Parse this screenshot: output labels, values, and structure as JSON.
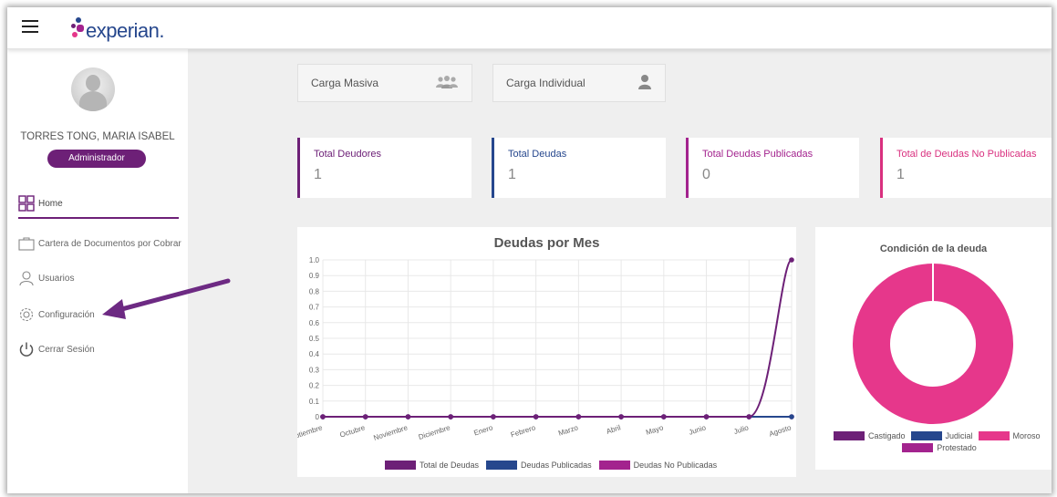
{
  "header": {
    "brand": "experian.",
    "menu_icon": "hamburger-menu-icon"
  },
  "sidebar": {
    "user_name": "TORRES TONG, MARIA ISABEL",
    "role": "Administrador",
    "items": [
      {
        "label": "Home",
        "icon": "grid-icon"
      },
      {
        "label": "Cartera de Documentos por Cobrar",
        "icon": "briefcase-icon"
      },
      {
        "label": "Usuarios",
        "icon": "user-icon"
      },
      {
        "label": "Configuración",
        "icon": "gear-icon"
      },
      {
        "label": "Cerrar Sesión",
        "icon": "power-icon"
      }
    ]
  },
  "upload": {
    "masiva": {
      "label": "Carga Masiva",
      "icon": "users-group-icon"
    },
    "individual": {
      "label": "Carga Individual",
      "icon": "person-icon"
    }
  },
  "stats": [
    {
      "label": "Total Deudores",
      "value": "1",
      "color": "#6d2077"
    },
    {
      "label": "Total Deudas",
      "value": "1",
      "color": "#26478d"
    },
    {
      "label": "Total Deudas Publicadas",
      "value": "0",
      "color": "#a3238e"
    },
    {
      "label": "Total de Deudas No Publicadas",
      "value": "1",
      "color": "#d9307f"
    }
  ],
  "chart_data": [
    {
      "type": "line",
      "title": "Deudas por Mes",
      "categories": [
        "Septiembre",
        "Octubre",
        "Noviembre",
        "Diciembre",
        "Enero",
        "Febrero",
        "Marzo",
        "Abril",
        "Mayo",
        "Junio",
        "Julio",
        "Agosto"
      ],
      "ylim": [
        0,
        1.0
      ],
      "yticks": [
        "0",
        "0.1",
        "0.2",
        "0.3",
        "0.4",
        "0.5",
        "0.6",
        "0.7",
        "0.8",
        "0.9",
        "1.0"
      ],
      "grid": true,
      "legend_position": "bottom",
      "series": [
        {
          "name": "Total de Deudas",
          "color": "#6d2077",
          "values": [
            0,
            0,
            0,
            0,
            0,
            0,
            0,
            0,
            0,
            0,
            0,
            1
          ]
        },
        {
          "name": "Deudas Publicadas",
          "color": "#26478d",
          "values": [
            0,
            0,
            0,
            0,
            0,
            0,
            0,
            0,
            0,
            0,
            0,
            0
          ]
        },
        {
          "name": "Deudas No Publicadas",
          "color": "#a3238e",
          "values": [
            0,
            0,
            0,
            0,
            0,
            0,
            0,
            0,
            0,
            0,
            0,
            0
          ]
        }
      ]
    },
    {
      "type": "pie",
      "title": "Condición de la deuda",
      "legend_position": "bottom",
      "categories": [
        "Castigado",
        "Judicial",
        "Moroso",
        "Protestado"
      ],
      "values": [
        0,
        0,
        1,
        0
      ],
      "colors": [
        "#6d2077",
        "#26478d",
        "#e6378b",
        "#a3238e"
      ]
    }
  ],
  "colors": {
    "brand_purple": "#6d2077",
    "brand_blue": "#26478d",
    "annotation_arrow": "#6d2a83"
  }
}
